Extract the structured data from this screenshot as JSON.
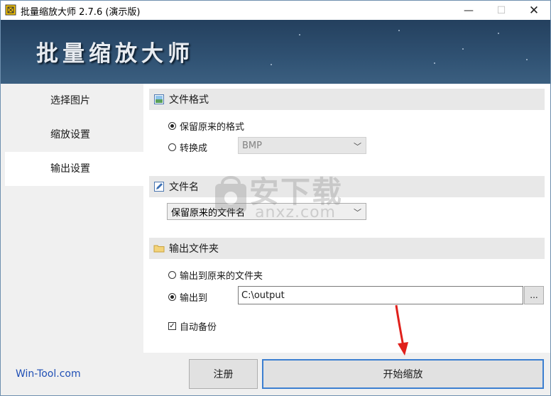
{
  "window": {
    "title": "批量缩放大师 2.7.6 (演示版)",
    "minimize_glyph": "—",
    "maximize_glyph": "☐",
    "close_glyph": "✕"
  },
  "banner": {
    "title": "批量缩放大师"
  },
  "sidebar": {
    "items": [
      {
        "label": "选择图片",
        "active": false
      },
      {
        "label": "缩放设置",
        "active": false
      },
      {
        "label": "输出设置",
        "active": true
      }
    ]
  },
  "format_section": {
    "title": "文件格式",
    "icon": "image-file-icon",
    "keep_label": "保留原来的格式",
    "keep_checked": true,
    "convert_label": "转换成",
    "convert_checked": false,
    "convert_value": "BMP"
  },
  "filename_section": {
    "title": "文件名",
    "icon": "edit-icon",
    "value": "保留原来的文件名"
  },
  "folder_section": {
    "title": "输出文件夹",
    "icon": "folder-icon",
    "original_label": "输出到原来的文件夹",
    "original_checked": false,
    "output_label": "输出到",
    "output_checked": true,
    "output_path": "C:\\output",
    "browse_label": "...",
    "backup_label": "自动备份",
    "backup_checked": true
  },
  "watermark": {
    "cn": "安下载",
    "en": "anxz.com"
  },
  "footer": {
    "link": "Win-Tool.com",
    "register_label": "注册",
    "start_label": "开始缩放"
  },
  "colors": {
    "banner": "#305273",
    "accent_border": "#3c7fd0",
    "link": "#1f4fb5",
    "arrow": "#e0201b"
  }
}
